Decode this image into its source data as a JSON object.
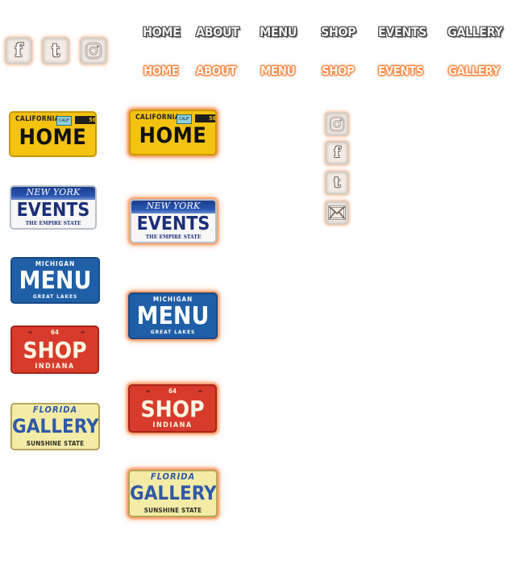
{
  "nav": {
    "items": [
      {
        "label": "HOME"
      },
      {
        "label": "ABOUT"
      },
      {
        "label": "MENU"
      },
      {
        "label": "SHOP"
      },
      {
        "label": "EVENTS"
      },
      {
        "label": "GALLERY"
      }
    ]
  },
  "plates": {
    "home": {
      "top": "CALIFORNIA",
      "main": "HOME",
      "sticker1": "CALIF",
      "sticker2": "56"
    },
    "events": {
      "top": "NEW YORK",
      "main": "EVENTS",
      "bottom": "THE EMPIRE STATE"
    },
    "menu": {
      "top": "MICHIGAN",
      "main": "MENU",
      "bottom": "GREAT LAKES"
    },
    "shop": {
      "top": "64",
      "main": "SHOP",
      "bottom": "INDIANA"
    },
    "gallery": {
      "top": "FLORIDA",
      "main": "GALLERY",
      "bottom": "SUNSHINE STATE"
    }
  },
  "social": {
    "facebook_glyph": "f",
    "twitter_glyph": "t",
    "icons": [
      "facebook-icon",
      "twitter-icon",
      "instagram-icon",
      "mail-icon"
    ]
  },
  "colors": {
    "glow": "#ff7a2e",
    "ca_yellow": "#f4c310",
    "mi_blue": "#1f5fa7",
    "in_red": "#d83b2c",
    "fl_cream": "#f4eca6",
    "ny_blue": "#1b2f7a"
  }
}
